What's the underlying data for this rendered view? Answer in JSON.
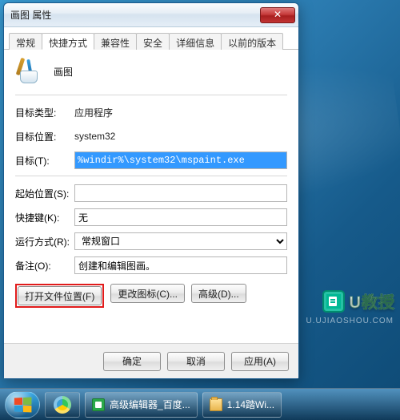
{
  "dialog": {
    "title": "画图 属性",
    "tabs": [
      "常规",
      "快捷方式",
      "兼容性",
      "安全",
      "详细信息",
      "以前的版本"
    ],
    "active_tab_index": 1,
    "app_name": "画图",
    "fields": {
      "target_type_label": "目标类型:",
      "target_type_value": "应用程序",
      "target_location_label": "目标位置:",
      "target_location_value": "system32",
      "target_label": "目标(T):",
      "target_value": "%windir%\\system32\\mspaint.exe",
      "start_in_label": "起始位置(S):",
      "start_in_value": "",
      "shortcut_key_label": "快捷键(K):",
      "shortcut_key_value": "无",
      "run_label": "运行方式(R):",
      "run_value": "常规窗口",
      "comment_label": "备注(O):",
      "comment_value": "创建和编辑图画。"
    },
    "buttons": {
      "open_file_location": "打开文件位置(F)",
      "change_icon": "更改图标(C)...",
      "advanced": "高级(D)..."
    },
    "footer": {
      "ok": "确定",
      "cancel": "取消",
      "apply": "应用(A)"
    }
  },
  "watermark": {
    "brand": "U教授",
    "url": "U.UJIAOSHOU.COM"
  },
  "taskbar": {
    "task1": "高级编辑器_百度...",
    "task2": "1.14踏Wi..."
  }
}
